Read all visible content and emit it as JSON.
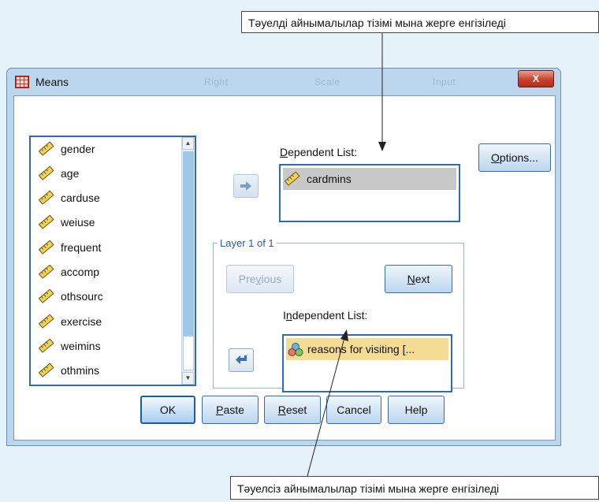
{
  "annotations": {
    "top": "Тәуелді айнымалылар тізімі мына жерге енгізіледі",
    "bottom": "Тәуелсіз айнымалылар тізімі мына жерге енгізіледі"
  },
  "window": {
    "title": "Means",
    "ghost_menu": [
      "Right",
      "Scale",
      "Input"
    ],
    "close_label": "X"
  },
  "variables": {
    "items": [
      {
        "label": "gender",
        "icon": "scale-ruler-icon"
      },
      {
        "label": "age",
        "icon": "scale-ruler-icon"
      },
      {
        "label": "carduse",
        "icon": "scale-ruler-icon"
      },
      {
        "label": "weiuse",
        "icon": "scale-ruler-icon"
      },
      {
        "label": "frequent",
        "icon": "scale-ruler-icon"
      },
      {
        "label": "accomp",
        "icon": "scale-ruler-icon"
      },
      {
        "label": "othsourc",
        "icon": "scale-ruler-icon"
      },
      {
        "label": "exercise",
        "icon": "scale-ruler-icon"
      },
      {
        "label": "weimins",
        "icon": "scale-ruler-icon"
      },
      {
        "label": "othmins",
        "icon": "scale-ruler-icon"
      }
    ]
  },
  "dependent": {
    "label_prefix": "D",
    "label_rest": "ependent List:",
    "items": [
      {
        "label": "cardmins",
        "icon": "scale-ruler-icon"
      }
    ]
  },
  "layer": {
    "legend": "Layer 1 of 1",
    "previous_pre": "Pre",
    "previous_u": "v",
    "previous_post": "ious",
    "next_u": "N",
    "next_post": "ext"
  },
  "independent": {
    "label_pre": "I",
    "label_u": "n",
    "label_post": "dependent List:",
    "items": [
      {
        "label": "reasons for visiting [...",
        "icon": "nominal-circles-icon"
      }
    ]
  },
  "buttons": {
    "options_pre": "O",
    "options_post": "ptions...",
    "ok": "OK",
    "paste_u": "P",
    "paste_post": "aste",
    "reset_u": "R",
    "reset_post": "eset",
    "cancel": "Cancel",
    "help": "Help"
  },
  "colors": {
    "accent": "#2e6bb6",
    "dependent_selection": "#c8c8c8",
    "independent_selection": "#f5dc95"
  }
}
